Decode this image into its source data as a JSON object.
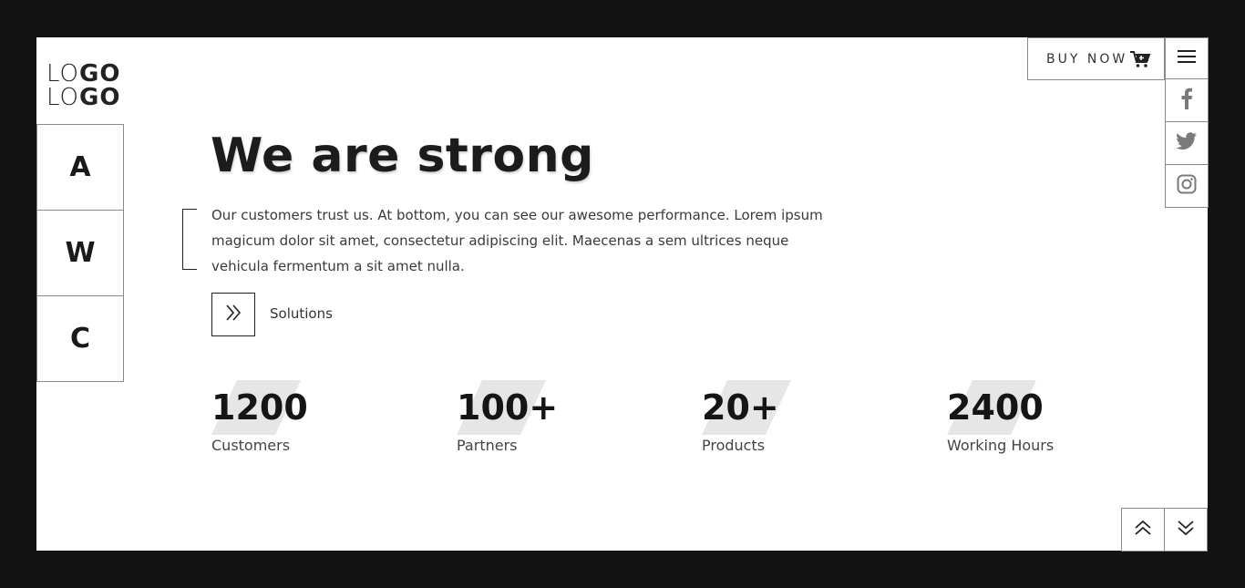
{
  "logo": {
    "line1_light": "LO",
    "line1_bold": "GO",
    "line2_light": "LO",
    "line2_bold": "GO"
  },
  "side_nav": {
    "items": [
      "A",
      "W",
      "C"
    ]
  },
  "header": {
    "buy_now_label": "BUY NOW"
  },
  "social": {
    "icons": [
      "facebook-icon",
      "twitter-icon",
      "instagram-icon"
    ]
  },
  "hero": {
    "title": "We are strong",
    "text": "Our customers trust us. At bottom, you can see our awesome performance. Lorem ipsum magicum dolor sit amet, consectetur adipiscing elit. Maecenas a sem ultrices neque vehicula fermentum a sit amet nulla.",
    "cta_label": "Solutions"
  },
  "stats": [
    {
      "value": "1200",
      "label": "Customers"
    },
    {
      "value": "100+",
      "label": "Partners"
    },
    {
      "value": "20+",
      "label": "Products"
    },
    {
      "value": "2400",
      "label": "Working Hours"
    }
  ],
  "colors": {
    "frame": "#121212",
    "page": "#ffffff",
    "text": "#1c1c1c",
    "stat_bg": "#e6e6e6"
  }
}
